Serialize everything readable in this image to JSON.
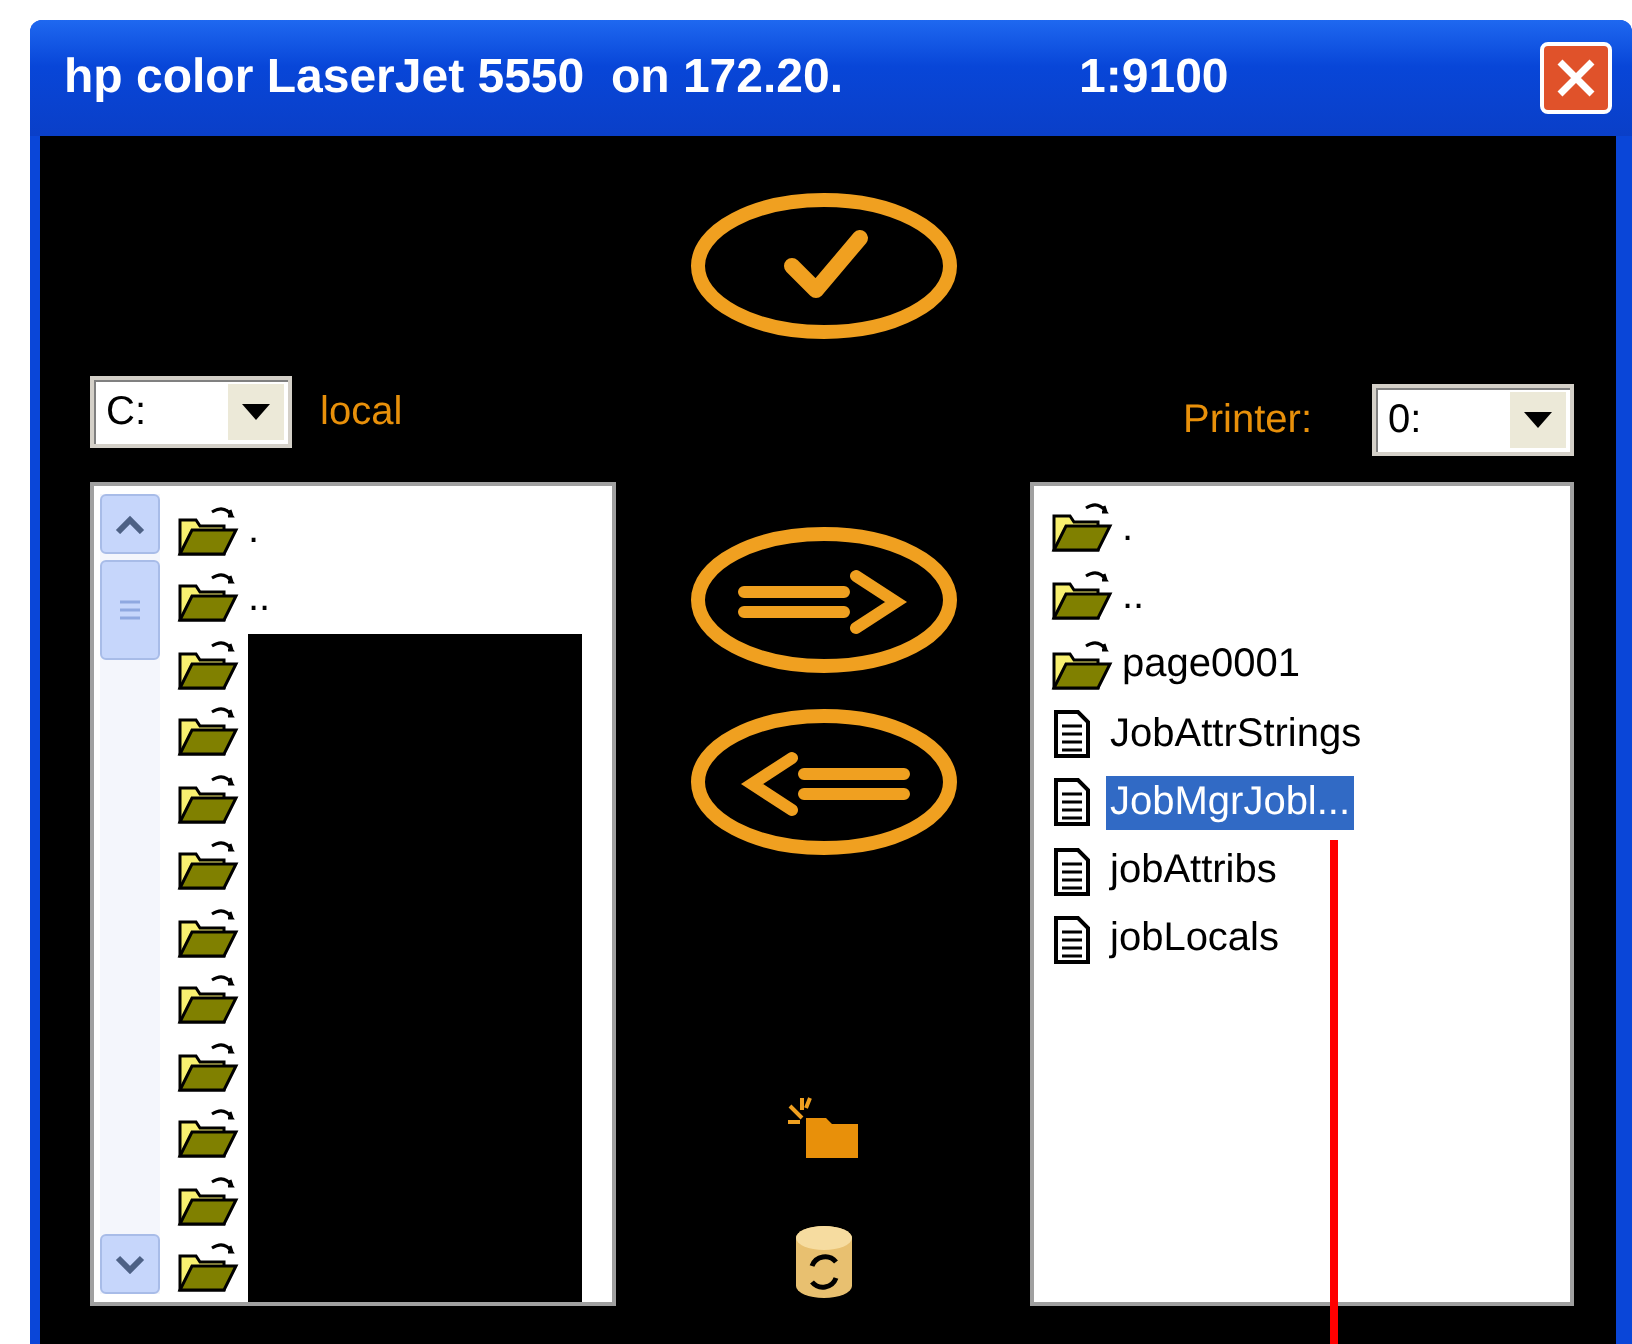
{
  "window": {
    "title": "hp color LaserJet 5550  on 172.20.",
    "title_suffix": "1:9100"
  },
  "local": {
    "drive": "C:",
    "label": "local",
    "items": [
      {
        "kind": "folder",
        "name": "."
      },
      {
        "kind": "folder",
        "name": ".."
      },
      {
        "kind": "folder"
      },
      {
        "kind": "folder"
      },
      {
        "kind": "folder"
      },
      {
        "kind": "folder"
      },
      {
        "kind": "folder"
      },
      {
        "kind": "folder"
      },
      {
        "kind": "folder"
      },
      {
        "kind": "folder"
      },
      {
        "kind": "folder"
      },
      {
        "kind": "folder"
      }
    ]
  },
  "printer": {
    "label": "Printer:",
    "disk": "0:",
    "items": [
      {
        "kind": "folder",
        "name": ".",
        "selected": false
      },
      {
        "kind": "folder",
        "name": "..",
        "selected": false
      },
      {
        "kind": "folder",
        "name": "page0001",
        "selected": false
      },
      {
        "kind": "file",
        "name": "JobAttrStrings",
        "selected": false
      },
      {
        "kind": "file",
        "name": "JobMgrJobl...",
        "selected": true
      },
      {
        "kind": "file",
        "name": "jobAttribs",
        "selected": false
      },
      {
        "kind": "file",
        "name": "jobLocals",
        "selected": false
      }
    ]
  }
}
